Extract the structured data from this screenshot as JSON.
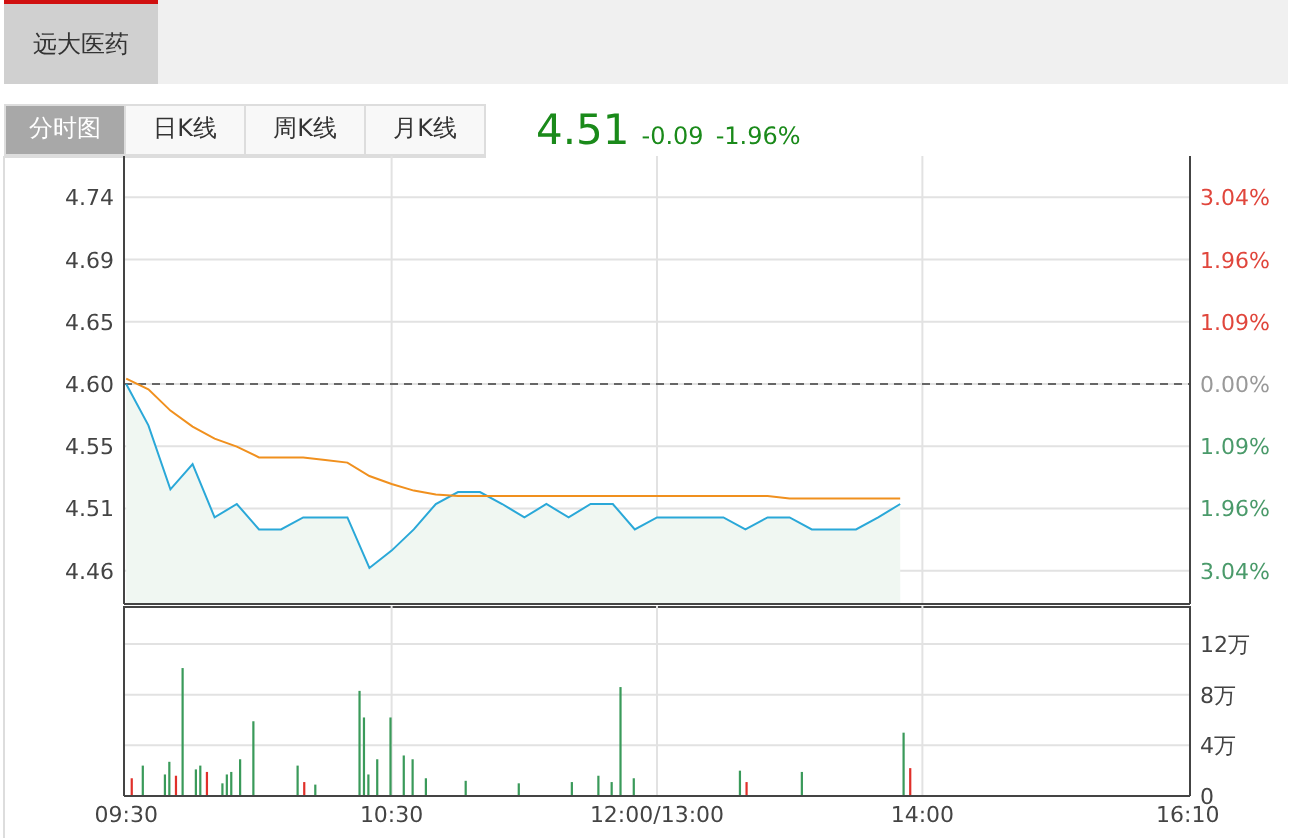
{
  "stock_tabs": [
    {
      "label": "远大医药",
      "selected": true
    }
  ],
  "chart_tabs": [
    {
      "label": "分时图",
      "selected": true
    },
    {
      "label": "日K线",
      "selected": false
    },
    {
      "label": "周K线",
      "selected": false
    },
    {
      "label": "月K线",
      "selected": false
    }
  ],
  "quote": {
    "price": "4.51",
    "change": "-0.09",
    "change_percent": "-1.96%"
  },
  "price_chart": {
    "right_ticks": [
      {
        "label": "3.04%",
        "color": "#e0463c"
      },
      {
        "label": "1.96%",
        "color": "#e0463c"
      },
      {
        "label": "1.09%",
        "color": "#e0463c"
      },
      {
        "label": "0.00%",
        "color": "#999999"
      },
      {
        "label": "1.09%",
        "color": "#4a9a6a"
      },
      {
        "label": "1.96%",
        "color": "#4a9a6a"
      },
      {
        "label": "3.04%",
        "color": "#4a9a6a"
      }
    ],
    "chart_data": {
      "type": "line",
      "grid": true,
      "categories": [
        null,
        null,
        null,
        null,
        null,
        null,
        null,
        null,
        null,
        null,
        null,
        null,
        null,
        null,
        null,
        null,
        null,
        null,
        null,
        null,
        null,
        null,
        null,
        null,
        null,
        null,
        null,
        null,
        null,
        null,
        null,
        null,
        null,
        null,
        null,
        null
      ],
      "series": [
        {
          "color": "#2aa8d8",
          "values": [
            4.6,
            4.569,
            4.521,
            4.54,
            4.5,
            4.51,
            4.491,
            4.491,
            4.5,
            4.5,
            4.5,
            4.462,
            4.475,
            4.491,
            4.51,
            4.519,
            4.519,
            4.51,
            4.5,
            4.51,
            4.5,
            4.51,
            4.51,
            4.491,
            4.5,
            4.5,
            4.5,
            4.5,
            4.491,
            4.5,
            4.5,
            4.491,
            4.491,
            4.491,
            4.5,
            4.51
          ]
        },
        {
          "color": "#f0901e",
          "values": [
            4.604,
            4.596,
            4.58,
            4.568,
            4.559,
            4.553,
            4.545,
            4.545,
            4.545,
            4.543,
            4.541,
            4.531,
            4.525,
            4.52,
            4.517,
            4.516,
            4.516,
            4.516,
            4.516,
            4.516,
            4.516,
            4.516,
            4.516,
            4.516,
            4.516,
            4.516,
            4.516,
            4.516,
            4.516,
            4.516,
            4.514,
            4.514,
            4.514,
            4.514,
            4.514,
            4.514
          ]
        }
      ],
      "ylim": [
        4.435,
        4.771
      ],
      "yticks": [
        {
          "value": 4.74,
          "label": "4.74"
        },
        {
          "value": 4.6933,
          "label": "4.69"
        },
        {
          "value": 4.6467,
          "label": "4.65"
        },
        {
          "value": 4.6,
          "label": "4.60"
        },
        {
          "value": 4.5533,
          "label": "4.55"
        },
        {
          "value": 4.5067,
          "label": "4.51"
        },
        {
          "value": 4.46,
          "label": "4.46"
        }
      ],
      "ref_lines": [
        {
          "axis": "y",
          "value": 4.6
        }
      ]
    }
  },
  "volume_chart": {
    "chart_data": {
      "type": "bar",
      "stacked": false,
      "grid": true,
      "categories": [
        "09:30",
        null,
        null,
        null,
        null,
        null,
        null,
        null,
        null,
        null,
        null,
        null,
        null,
        null,
        null,
        null,
        null,
        null,
        null,
        null,
        null,
        null,
        null,
        null,
        null,
        null,
        null,
        null,
        null,
        null,
        null,
        null,
        null,
        null,
        null,
        null,
        null,
        null,
        null,
        null,
        null,
        null,
        null,
        null,
        null,
        null,
        null,
        null,
        null,
        null,
        null,
        null,
        null,
        null,
        null,
        null,
        null,
        null,
        null,
        null,
        "10:30",
        null,
        null,
        null,
        null,
        null,
        null,
        null,
        null,
        null,
        null,
        null,
        null,
        null,
        null,
        null,
        null,
        null,
        null,
        null,
        null,
        null,
        null,
        null,
        null,
        null,
        null,
        null,
        null,
        null,
        null,
        null,
        null,
        null,
        null,
        null,
        null,
        null,
        null,
        null,
        null,
        null,
        null,
        null,
        null,
        null,
        null,
        null,
        null,
        null,
        null,
        null,
        null,
        null,
        null,
        null,
        null,
        null,
        null,
        null,
        "12:00/13:00",
        null,
        null,
        null,
        null,
        null,
        null,
        null,
        null,
        null,
        null,
        null,
        null,
        null,
        null,
        null,
        null,
        null,
        null,
        null,
        null,
        null,
        null,
        null,
        null,
        null,
        null,
        null,
        null,
        null,
        null,
        null,
        null,
        null,
        null,
        null,
        null,
        null,
        null,
        null,
        null,
        null,
        null,
        null,
        null,
        null,
        null,
        null,
        null,
        null,
        null,
        null,
        null,
        null,
        null,
        null,
        null,
        null,
        null,
        null,
        "14:00",
        null,
        null,
        null,
        null,
        null,
        null,
        null,
        null,
        null,
        null,
        null,
        null,
        null,
        null,
        null,
        null,
        null,
        null,
        null,
        null,
        null,
        null,
        null,
        null,
        null,
        null,
        null,
        null,
        null,
        null,
        null,
        null,
        null,
        null,
        null,
        null,
        null,
        null,
        null,
        null,
        null,
        null,
        null,
        null,
        null,
        null,
        null,
        null,
        null,
        null,
        null,
        null,
        null,
        null,
        null,
        null,
        null,
        null,
        null,
        "16:10"
      ],
      "series": [
        {
          "color": "#3a9a5a",
          "values": [
            null,
            null,
            null,
            null,
            2.4,
            null,
            null,
            null,
            null,
            1.7,
            2.7,
            null,
            null,
            10.1,
            null,
            null,
            2.1,
            2.4,
            null,
            null,
            null,
            null,
            1.0,
            1.7,
            1.9,
            null,
            2.9,
            null,
            null,
            5.9,
            null,
            null,
            null,
            null,
            null,
            null,
            null,
            null,
            null,
            2.4,
            null,
            null,
            null,
            0.9,
            null,
            null,
            null,
            null,
            null,
            null,
            null,
            null,
            null,
            8.3,
            6.2,
            1.7,
            null,
            2.9,
            null,
            null,
            6.2,
            null,
            null,
            3.2,
            null,
            2.9,
            null,
            null,
            1.4,
            null,
            null,
            null,
            null,
            null,
            null,
            null,
            null,
            1.2,
            null,
            null,
            null,
            null,
            null,
            null,
            null,
            null,
            null,
            null,
            null,
            1.0,
            null,
            null,
            null,
            null,
            null,
            null,
            null,
            null,
            null,
            null,
            null,
            1.1,
            null,
            null,
            null,
            null,
            null,
            1.6,
            null,
            null,
            1.1,
            null,
            8.6,
            null,
            null,
            1.4,
            null,
            null,
            null,
            null,
            null,
            null,
            null,
            null,
            null,
            null,
            null,
            null,
            null,
            null,
            null,
            null,
            null,
            null,
            null,
            null,
            null,
            null,
            null,
            2.0,
            null,
            null,
            null,
            null,
            null,
            null,
            null,
            null,
            null,
            null,
            null,
            null,
            null,
            1.9,
            null,
            null,
            null,
            null,
            null,
            null,
            null,
            null,
            null,
            null,
            null,
            null,
            null,
            null,
            null,
            null,
            null,
            null,
            null,
            null,
            null,
            null,
            5.0,
            null,
            null,
            null,
            null,
            null,
            null,
            null,
            null,
            null,
            null,
            null,
            null,
            null,
            null,
            null,
            null,
            null,
            null,
            null,
            null,
            null,
            null,
            null,
            null,
            null,
            null,
            null,
            null,
            null,
            null,
            null,
            null,
            null,
            null,
            null,
            null,
            null,
            null,
            null,
            null,
            null,
            null,
            null,
            null,
            null,
            null,
            null,
            null,
            null,
            null,
            null,
            null,
            null,
            null,
            null,
            null,
            null,
            null,
            null,
            null,
            null,
            null,
            null,
            null
          ]
        },
        {
          "color": "#e0302a",
          "values": [
            null,
            1.4,
            null,
            null,
            null,
            null,
            null,
            null,
            null,
            null,
            null,
            1.6,
            null,
            null,
            null,
            null,
            null,
            null,
            1.9,
            null,
            null,
            null,
            null,
            null,
            null,
            null,
            null,
            null,
            null,
            null,
            null,
            null,
            null,
            null,
            null,
            null,
            null,
            null,
            null,
            null,
            1.1,
            null,
            null,
            null,
            null,
            null,
            null,
            null,
            null,
            null,
            null,
            null,
            null,
            null,
            null,
            null,
            null,
            null,
            null,
            null,
            null,
            null,
            null,
            null,
            null,
            null,
            null,
            null,
            null,
            null,
            null,
            null,
            null,
            null,
            null,
            null,
            null,
            null,
            null,
            null,
            null,
            null,
            null,
            null,
            null,
            null,
            null,
            null,
            null,
            null,
            null,
            null,
            null,
            null,
            null,
            null,
            null,
            null,
            null,
            null,
            null,
            null,
            null,
            null,
            null,
            null,
            null,
            null,
            null,
            null,
            null,
            null,
            null,
            null,
            null,
            null,
            null,
            null,
            null,
            null,
            null,
            null,
            null,
            null,
            null,
            null,
            null,
            null,
            null,
            null,
            null,
            null,
            null,
            null,
            null,
            null,
            null,
            null,
            null,
            null,
            1.1,
            null,
            null,
            null,
            null,
            null,
            null,
            null,
            null,
            null,
            null,
            null,
            null,
            null,
            null,
            null,
            null,
            null,
            null,
            null,
            null,
            null,
            null,
            null,
            null,
            null,
            null,
            null,
            null,
            null,
            null,
            null,
            null,
            null,
            null,
            null,
            null,
            2.2,
            null,
            null,
            null,
            null,
            null,
            null,
            null,
            null,
            null,
            null,
            null,
            null,
            null,
            null,
            null,
            null,
            null,
            null,
            null,
            null,
            null,
            null,
            null,
            null,
            null,
            null,
            null,
            null,
            null,
            null,
            null,
            null,
            null,
            null,
            null,
            null,
            null,
            null,
            null,
            null,
            null,
            null,
            null,
            null,
            null,
            null,
            null,
            null,
            null,
            null,
            null,
            null,
            null,
            null,
            null,
            null,
            null,
            null,
            null,
            null,
            null,
            null,
            null
          ]
        }
      ],
      "ylim": [
        0,
        15
      ],
      "yticks": [
        {
          "value": 0,
          "label": "0"
        },
        {
          "value": 4,
          "label": "4万"
        },
        {
          "value": 8,
          "label": "8万"
        },
        {
          "value": 12,
          "label": "12万"
        }
      ]
    }
  }
}
